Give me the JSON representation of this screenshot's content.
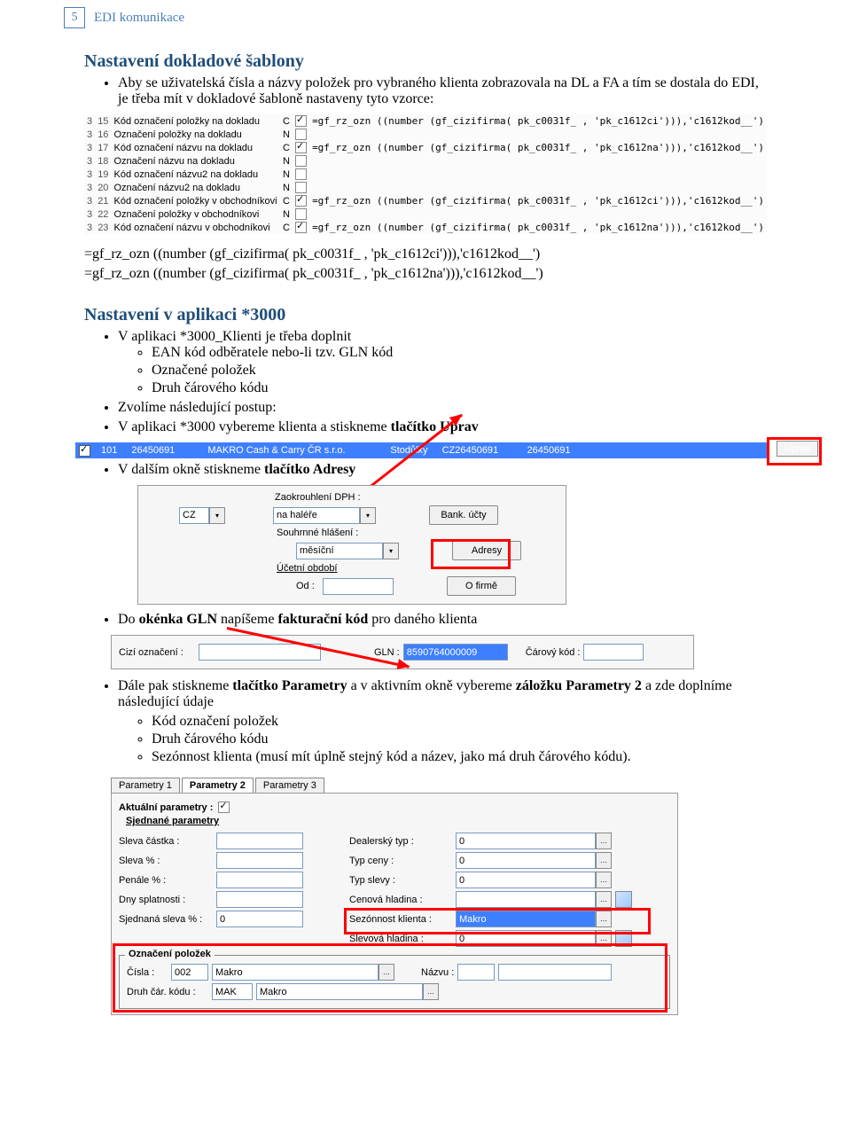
{
  "header": {
    "page": "5",
    "title": "EDI komunikace"
  },
  "s1": {
    "heading": "Nastavení dokladové šablony",
    "intro": "Aby se uživatelská čísla a názvy položek pro vybraného klienta zobrazovala na DL a FA a tím se dostala do EDI,  je třeba mít v dokladové šabloně nastaveny tyto vzorce:",
    "rows": [
      {
        "a": "3",
        "b": "15",
        "t": "Kód označení položky na dokladu",
        "c": "C",
        "chk": true,
        "f": "=gf_rz_ozn ((number (gf_cizifirma( pk_c0031f_ , 'pk_c1612ci'))),'c1612kod__')"
      },
      {
        "a": "3",
        "b": "16",
        "t": "Označení položky na dokladu",
        "c": "N",
        "chk": false,
        "f": ""
      },
      {
        "a": "3",
        "b": "17",
        "t": "Kód označení názvu na dokladu",
        "c": "C",
        "chk": true,
        "f": "=gf_rz_ozn ((number (gf_cizifirma( pk_c0031f_ , 'pk_c1612na'))),'c1612kod__')"
      },
      {
        "a": "3",
        "b": "18",
        "t": "Označení názvu na dokladu",
        "c": "N",
        "chk": false,
        "f": ""
      },
      {
        "a": "3",
        "b": "19",
        "t": "Kód označení názvu2 na dokladu",
        "c": "N",
        "chk": false,
        "f": ""
      },
      {
        "a": "3",
        "b": "20",
        "t": "Označení názvu2 na dokladu",
        "c": "N",
        "chk": false,
        "f": ""
      },
      {
        "a": "3",
        "b": "21",
        "t": "Kód označení položky v obchodníkovi",
        "c": "C",
        "chk": true,
        "f": "=gf_rz_ozn ((number (gf_cizifirma( pk_c0031f_ , 'pk_c1612ci'))),'c1612kod__')"
      },
      {
        "a": "3",
        "b": "22",
        "t": "Označení položky v obchodníkovi",
        "c": "N",
        "chk": false,
        "f": ""
      },
      {
        "a": "3",
        "b": "23",
        "t": "Kód označení názvu v obchodníkovi",
        "c": "C",
        "chk": true,
        "f": "=gf_rz_ozn ((number (gf_cizifirma( pk_c0031f_ , 'pk_c1612na'))),'c1612kod__')"
      }
    ],
    "code1": "=gf_rz_ozn ((number (gf_cizifirma( pk_c0031f_ , 'pk_c1612ci'))),'c1612kod__')",
    "code2": "=gf_rz_ozn ((number (gf_cizifirma( pk_c0031f_ , 'pk_c1612na'))),'c1612kod__')"
  },
  "s2": {
    "heading": "Nastavení v aplikaci *3000",
    "li1": "V aplikaci *3000_Klienti je třeba doplnit",
    "li1a": "EAN kód odběratele nebo-li tzv. GLN kód",
    "li1b": "Označené položek",
    "li1c": "Druh čárového kódu",
    "li2": "Zvolíme následující postup:",
    "li3pre": "V aplikaci *3000 vybereme klienta a stiskneme ",
    "li3b": "tlačítko Uprav",
    "bar": {
      "c1": "101",
      "c2": "26450691",
      "c3": "MAKRO Cash & Carry ČR s.r.o.",
      "c4": "Stodůlky",
      "c5": "CZ26450691",
      "c6": "26450691",
      "btn": "Uprav"
    },
    "li4pre": "V dalším okně stiskneme ",
    "li4b": "tlačítko Adresy",
    "panel1": {
      "l1": "Zaokrouhlení DPH :",
      "v1": "na haléře",
      "cz": "CZ",
      "l2": "Souhrnné hlášení :",
      "v2": "měsíční",
      "l3": "Účetní období",
      "l4": "Od :",
      "b1": "Bank. účty",
      "b2": "Adresy",
      "b3": "O firmě"
    },
    "li5": "Do <b>okénka GLN</b> napíšeme <b>fakturační kód</b> pro daného klienta",
    "gln": {
      "l1": "Cizí označení :",
      "l2": "GLN :",
      "v2": "8590764000009",
      "l3": "Čárový kód :"
    },
    "li6": "Dále pak stiskneme <b>tlačítko Parametry</b> a v aktivním okně vybereme <b>záložku Parametry 2</b> a zde doplníme následující údaje",
    "li6a": "Kód označení položek",
    "li6b": "Druh čárového kódu",
    "li6c": "Sezónnost klienta (musí mít úplně stejný kód a název, jako má druh čárového kódu).",
    "panel2": {
      "tabs": [
        "Parametry 1",
        "Parametry 2",
        "Parametry 3"
      ],
      "ap": "Aktuální parametry :",
      "sj": "Sjednané parametry",
      "rowsL": [
        {
          "l": "Sleva částka :",
          "v": ""
        },
        {
          "l": "Sleva % :",
          "v": ""
        },
        {
          "l": "Penále % :",
          "v": ""
        },
        {
          "l": "Dny splatnosti :",
          "v": ""
        },
        {
          "l": "Sjednaná sleva % :",
          "v": "0"
        }
      ],
      "rowsR": [
        {
          "l": "Dealerský typ :",
          "v": "0"
        },
        {
          "l": "Typ ceny :",
          "v": "0"
        },
        {
          "l": "Typ slevy :",
          "v": "0"
        },
        {
          "l": "Cenová hladina :",
          "v": ""
        },
        {
          "l": "Sezónnost klienta :",
          "v": "Makro",
          "hl": true
        },
        {
          "l": "Slevová hladina :",
          "v": "0"
        }
      ],
      "fs": {
        "legend": "Označení položek",
        "l1": "Čísla :",
        "v1a": "002",
        "v1b": "Makro",
        "l2": "Názvu :",
        "l3": "Druh čár. kódu :",
        "v3a": "MAK",
        "v3b": "Makro"
      }
    }
  }
}
